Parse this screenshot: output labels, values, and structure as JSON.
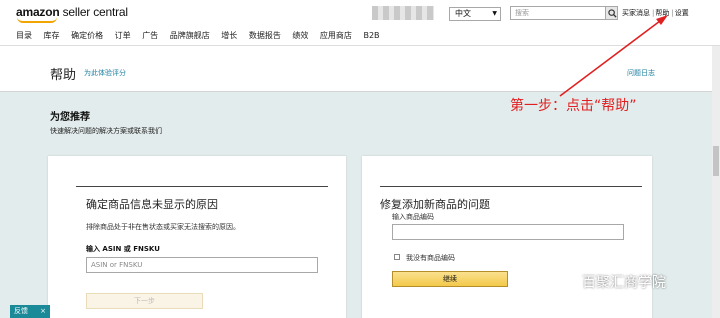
{
  "topbar": {
    "logo_bold": "amazon",
    "logo_rest": " seller central",
    "language": "中文",
    "search_placeholder": "搜索",
    "links": [
      "买家消息",
      "帮助",
      "设置"
    ]
  },
  "nav": {
    "items": [
      "目录",
      "库存",
      "确定价格",
      "订单",
      "广告",
      "品牌旗舰店",
      "增长",
      "数据报告",
      "绩效",
      "应用商店",
      "B2B"
    ]
  },
  "header": {
    "title": "帮助",
    "rate_link": "为此体验评分",
    "help_log": "问题日志"
  },
  "recommended": {
    "title": "为您推荐",
    "subtitle": "快速解决问题的解决方案或联系我们"
  },
  "annotation": {
    "text": "第一步：点击“帮助”",
    "color": "#e02020"
  },
  "card1": {
    "title": "确定商品信息未显示的原因",
    "desc": "排除商品处于非在售状态或买家无法搜索的原因。",
    "label": "输入 ASIN 或 FNSKU",
    "input_placeholder": "ASIN or FNSKU",
    "button": "下一步"
  },
  "card2": {
    "title": "修复添加新商品的问题",
    "input_label": "输入商品编码",
    "checkbox_label": "我没有商品编码",
    "button": "继续"
  },
  "watermark": "百聚汇商学院",
  "feedback": {
    "label": "反馈",
    "close": "×"
  }
}
